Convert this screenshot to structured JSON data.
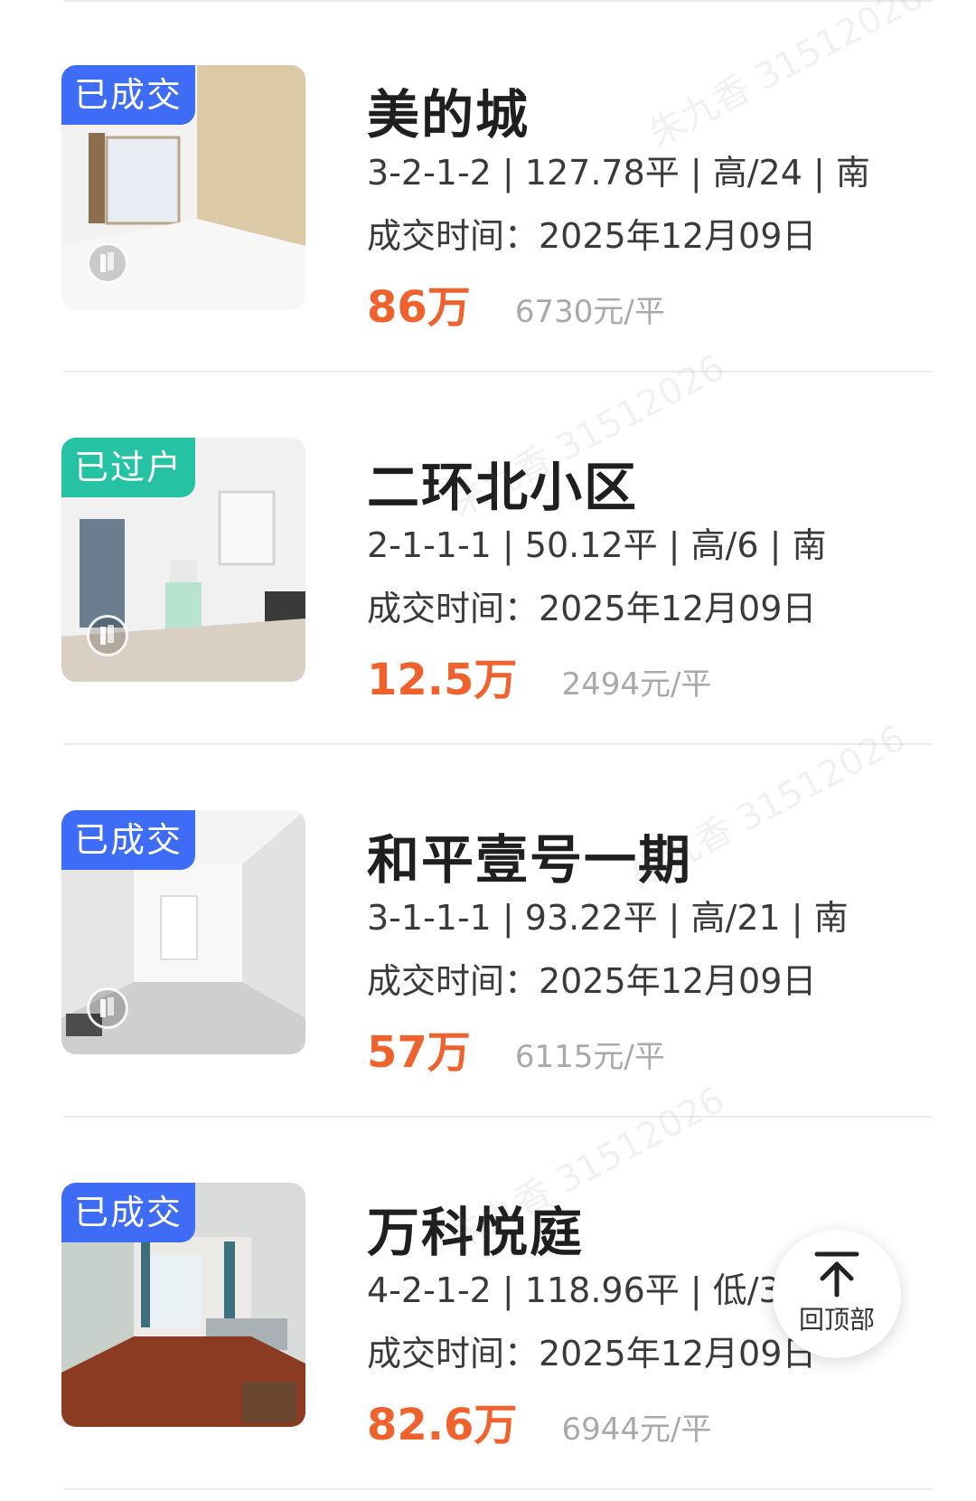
{
  "listings": [
    {
      "badge": "已成交",
      "badge_color": "#3f6cf6",
      "title": "美的城",
      "specs": "3-2-1-2 | 127.78平 | 高/24 | 南",
      "deal_date": "成交时间：2025年12月09日",
      "price": "86万",
      "unit_price": "6730元/平"
    },
    {
      "badge": "已过户",
      "badge_color": "#25c2a4",
      "title": "二环北小区",
      "specs": "2-1-1-1 | 50.12平 | 高/6 | 南",
      "deal_date": "成交时间：2025年12月09日",
      "price": "12.5万",
      "unit_price": "2494元/平"
    },
    {
      "badge": "已成交",
      "badge_color": "#3f6cf6",
      "title": "和平壹号一期",
      "specs": "3-1-1-1 | 93.22平 | 高/21 | 南",
      "deal_date": "成交时间：2025年12月09日",
      "price": "57万",
      "unit_price": "6115元/平"
    },
    {
      "badge": "已成交",
      "badge_color": "#3f6cf6",
      "title": "万科悦庭",
      "specs": "4-2-1-2 | 118.96平 | 低/34",
      "deal_date": "成交时间：2025年12月09日",
      "price": "82.6万",
      "unit_price": "6944元/平"
    }
  ],
  "back_to_top": {
    "label": "回顶部",
    "icon": "arrow-up-to-top-icon"
  },
  "watermark": "朱九香 31512026",
  "colors": {
    "price": "#f0622d",
    "badge_blue": "#3f6cf6",
    "badge_teal": "#25c2a4"
  }
}
